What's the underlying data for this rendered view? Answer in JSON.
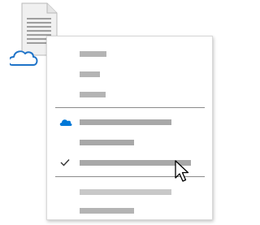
{
  "desktop": {
    "file_icon": "document-icon",
    "cloud_badge_icon": "cloud-outline-icon"
  },
  "context_menu": {
    "groups": [
      {
        "items": [
          {
            "icon": null,
            "checked": false,
            "label": ""
          },
          {
            "icon": null,
            "checked": false,
            "label": ""
          },
          {
            "icon": null,
            "checked": false,
            "label": ""
          }
        ]
      },
      {
        "items": [
          {
            "icon": "onedrive-cloud-icon",
            "checked": false,
            "label": ""
          },
          {
            "icon": null,
            "checked": false,
            "label": ""
          },
          {
            "icon": null,
            "checked": true,
            "check_icon": "checkmark-icon",
            "label": "",
            "hovered": true
          }
        ]
      },
      {
        "items": [
          {
            "icon": null,
            "checked": false,
            "label": ""
          },
          {
            "icon": null,
            "checked": false,
            "label": ""
          }
        ]
      }
    ]
  },
  "pointer": {
    "icon": "mouse-pointer-icon"
  },
  "colors": {
    "onedrive_blue": "#0078d7",
    "cloud_outline_blue": "#1e73c8",
    "placeholder_bar": "#b4b4b4",
    "divider": "#8a8a8a"
  }
}
